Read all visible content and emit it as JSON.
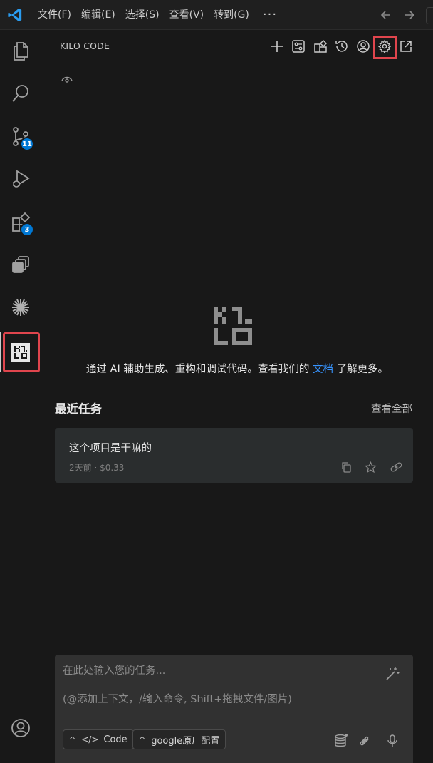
{
  "titlebar": {
    "menu": [
      {
        "label": "文件(F)"
      },
      {
        "label": "编辑(E)"
      },
      {
        "label": "选择(S)"
      },
      {
        "label": "查看(V)"
      },
      {
        "label": "转到(G)"
      }
    ],
    "more_label": "···"
  },
  "activitybar": {
    "source_control_badge": "11",
    "extensions_badge": "3"
  },
  "panel": {
    "title": "KILO CODE",
    "hero_text_before": "通过 AI 辅助生成、重构和调试代码。查看我们的",
    "hero_link": "文档",
    "hero_text_after": "了解更多。",
    "recent_title": "最近任务",
    "view_all": "查看全部",
    "task": {
      "title": "这个项目是干嘛的",
      "meta": "2天前 · $0.33"
    }
  },
  "input": {
    "placeholder": "在此处输入您的任务...",
    "hint": "(@添加上下文，/输入命令, Shift+拖拽文件/图片)",
    "mode_chip": "Code",
    "config_chip": "google原厂配置"
  },
  "colors": {
    "accent_blue": "#0078d4",
    "link_blue": "#3794ff",
    "highlight_red": "#e0454d"
  }
}
